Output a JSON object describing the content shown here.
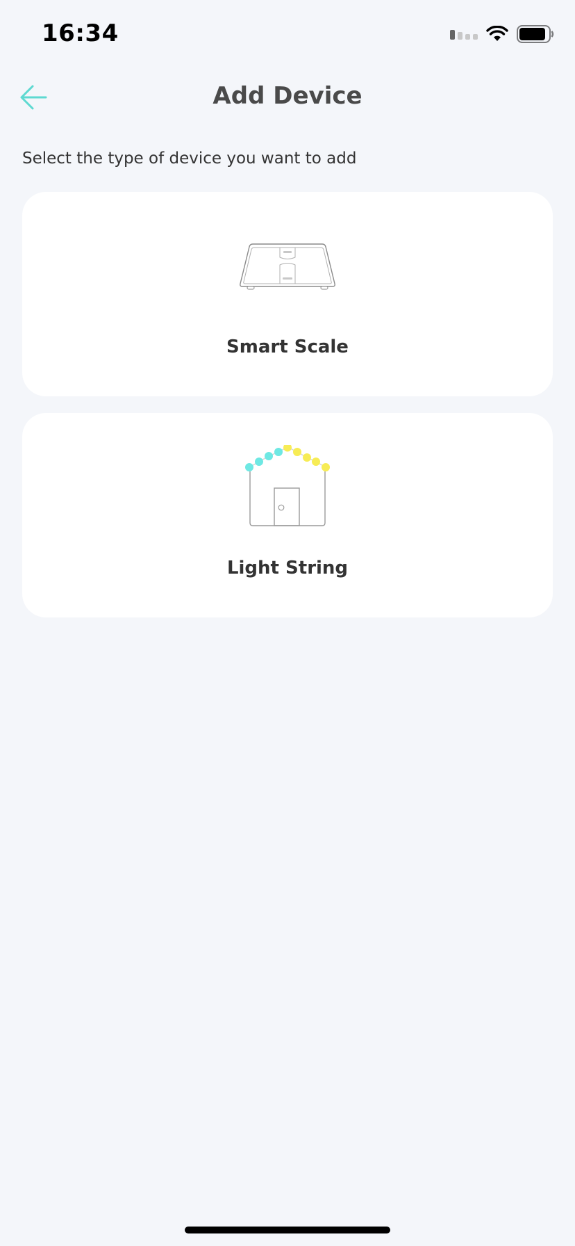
{
  "status_bar": {
    "time": "16:34"
  },
  "header": {
    "title": "Add Device",
    "back_icon": "arrow-left-icon"
  },
  "subtitle": "Select the type of device you want to add",
  "devices": [
    {
      "label": "Smart Scale",
      "icon": "smart-scale-illustration"
    },
    {
      "label": "Light String",
      "icon": "light-string-illustration"
    }
  ],
  "colors": {
    "accent": "#5ed9d1",
    "background": "#f4f6fa",
    "card": "#ffffff",
    "light_cyan": "#6ee8e3",
    "light_yellow": "#f7ec55"
  }
}
